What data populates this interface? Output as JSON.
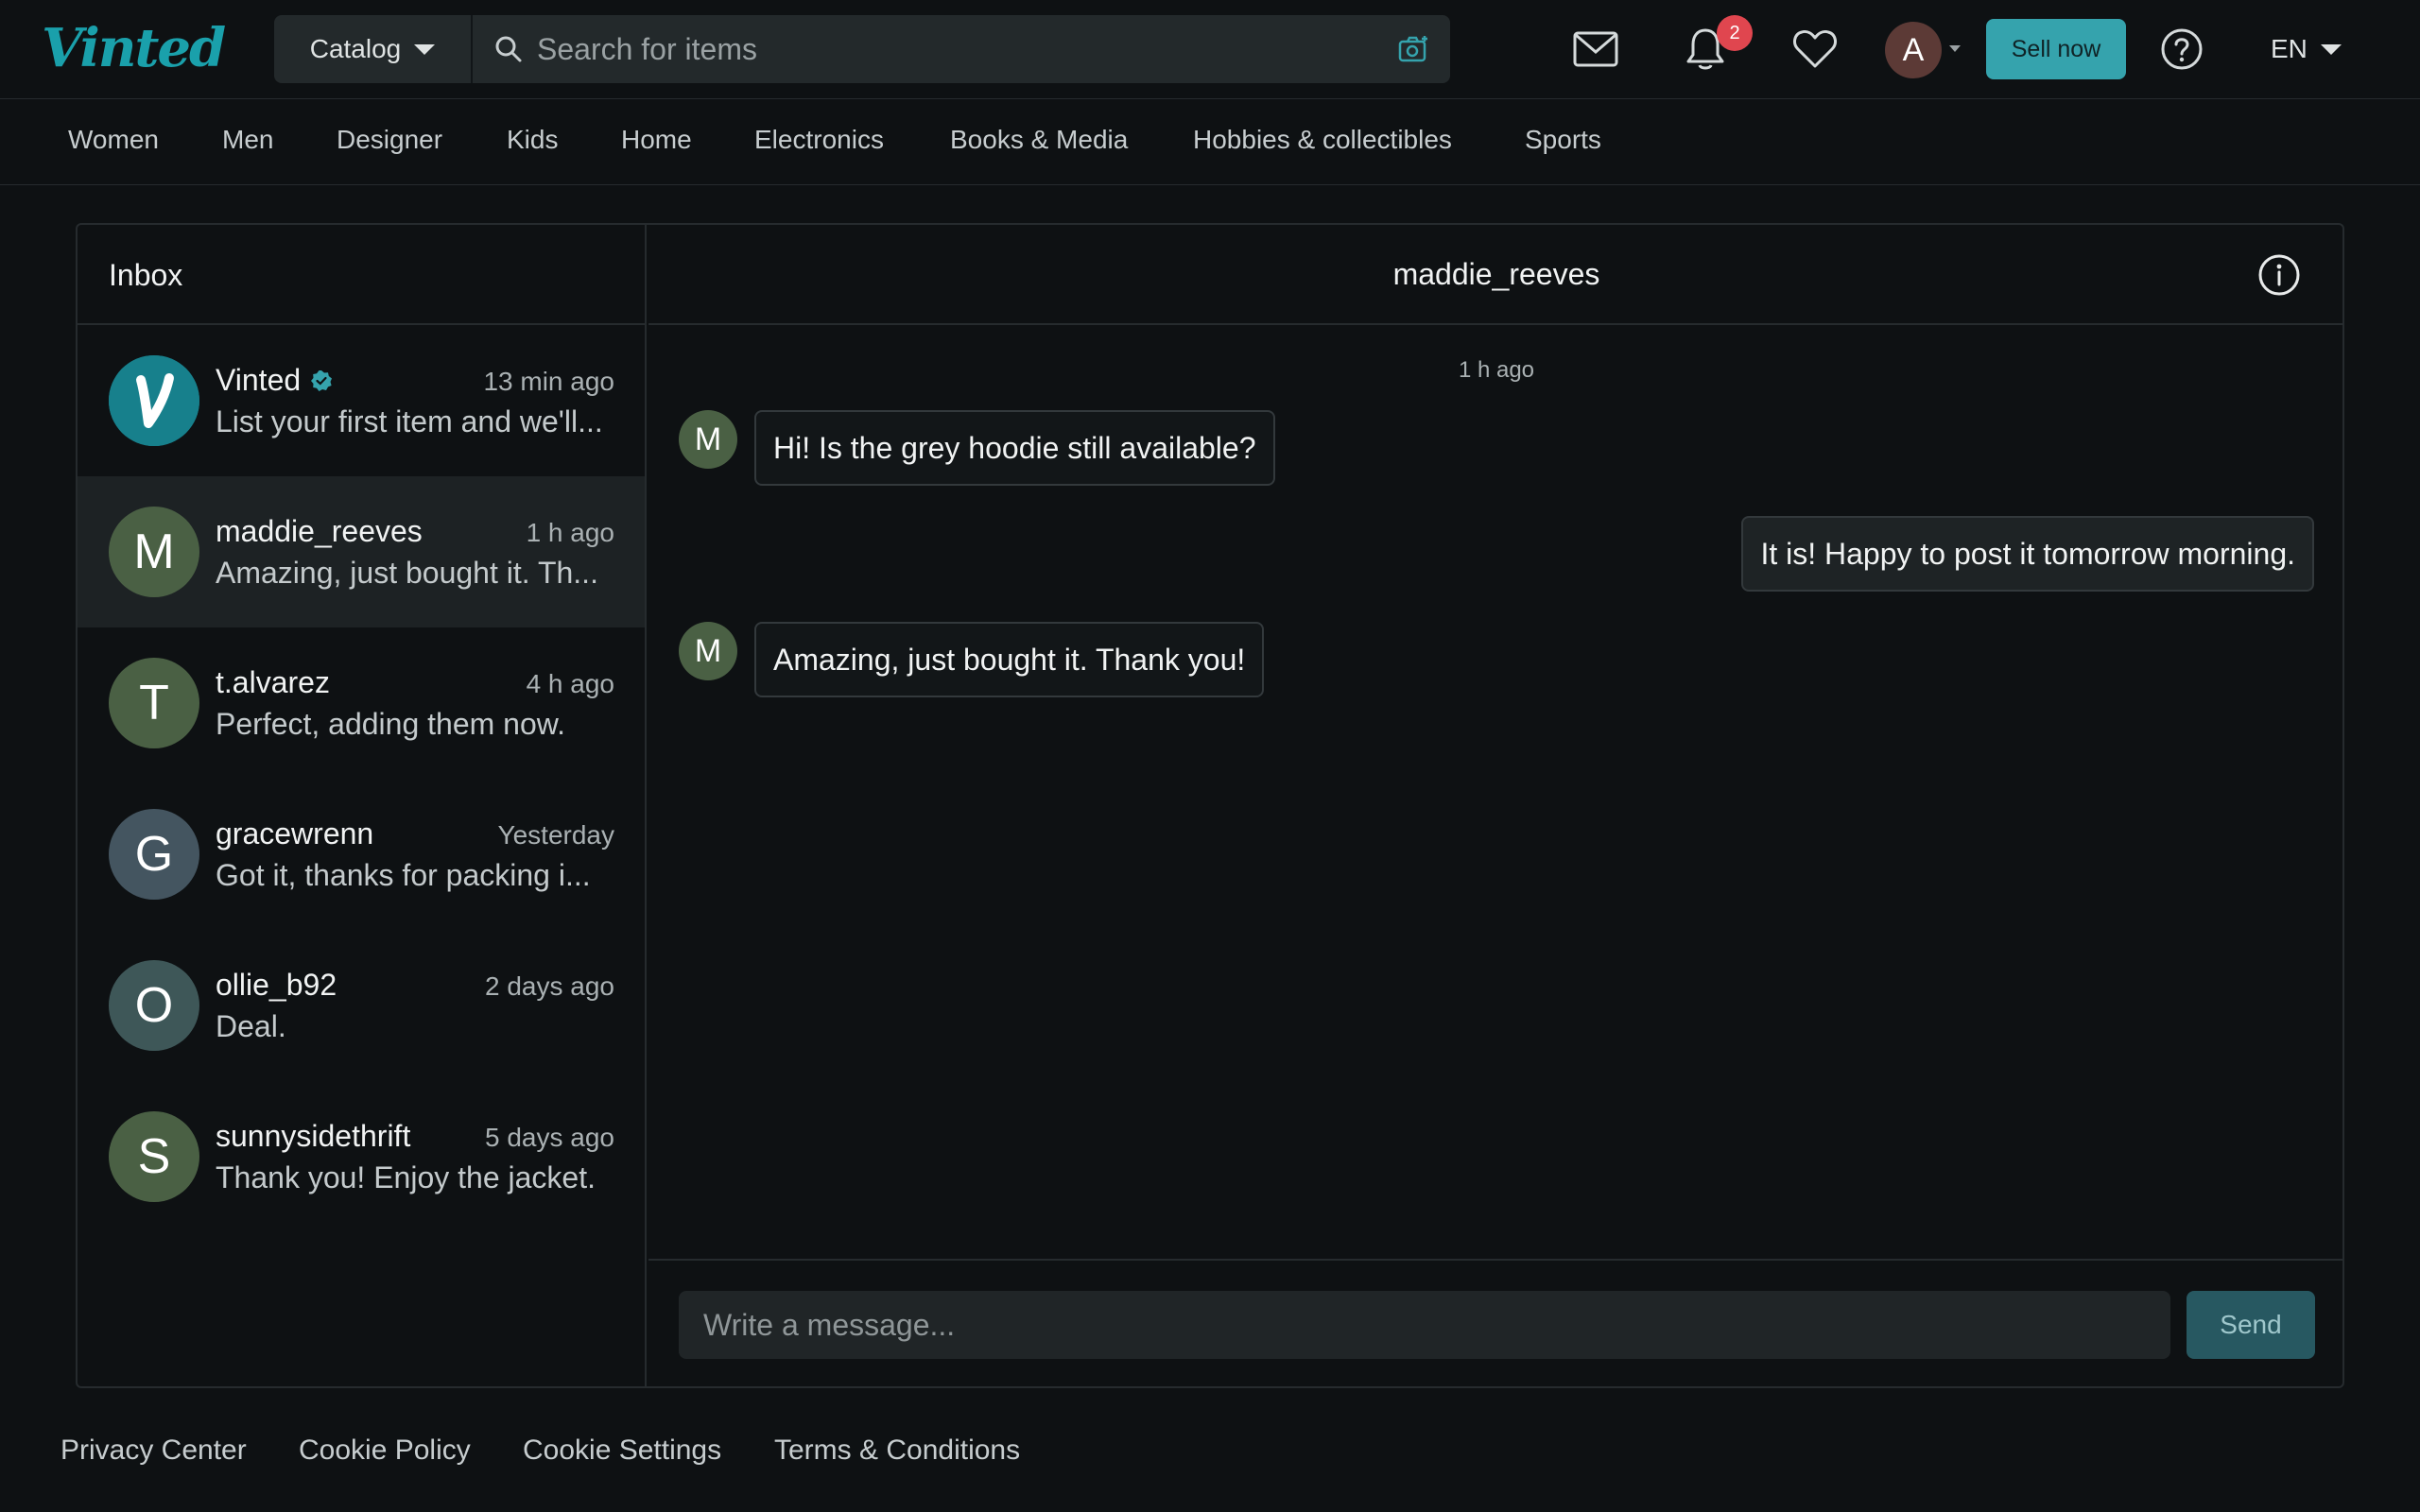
{
  "header": {
    "logo": "Vinted",
    "catalog_label": "Catalog",
    "search_placeholder": "Search for items",
    "notification_count": "2",
    "avatar_initial": "A",
    "sell_label": "Sell now",
    "language": "EN"
  },
  "categories": [
    "Women",
    "Men",
    "Designer",
    "Kids",
    "Home",
    "Electronics",
    "Books & Media",
    "Hobbies & collectibles",
    "Sports"
  ],
  "inbox": {
    "title": "Inbox",
    "conversations": [
      {
        "initial": "V",
        "name": "Vinted",
        "time": "13 min ago",
        "preview": "List your first item and we'll...",
        "color": "#1a7f8a",
        "verified": true
      },
      {
        "initial": "M",
        "name": "maddie_reeves",
        "time": "1 h ago",
        "preview": "Amazing, just bought it. Th...",
        "color": "#4a6044",
        "active": true
      },
      {
        "initial": "T",
        "name": "t.alvarez",
        "time": "4 h ago",
        "preview": "Perfect, adding them now.",
        "color": "#4a6044"
      },
      {
        "initial": "G",
        "name": "gracewrenn",
        "time": "Yesterday",
        "preview": "Got it, thanks for packing i...",
        "color": "#445560"
      },
      {
        "initial": "O",
        "name": "ollie_b92",
        "time": "2 days ago",
        "preview": "Deal.",
        "color": "#3e5758"
      },
      {
        "initial": "S",
        "name": "sunnysidethrift",
        "time": "5 days ago",
        "preview": "Thank you! Enjoy the jacket.",
        "color": "#4a6044"
      }
    ]
  },
  "chat": {
    "title": "maddie_reeves",
    "timestamp": "1 h ago",
    "partner_initial": "M",
    "messages": [
      {
        "from": "them",
        "text": "Hi! Is the grey hoodie still available?"
      },
      {
        "from": "me",
        "text": "It is! Happy to post it tomorrow morning."
      },
      {
        "from": "them",
        "text": "Amazing, just bought it. Thank you!"
      }
    ],
    "composer_placeholder": "Write a message...",
    "send_label": "Send"
  },
  "footer": {
    "links": [
      "Privacy Center",
      "Cookie Policy",
      "Cookie Settings",
      "Terms & Conditions"
    ]
  },
  "colors": {
    "accent": "#35a3ad",
    "background": "#0e1113",
    "badge": "#e0464f"
  }
}
